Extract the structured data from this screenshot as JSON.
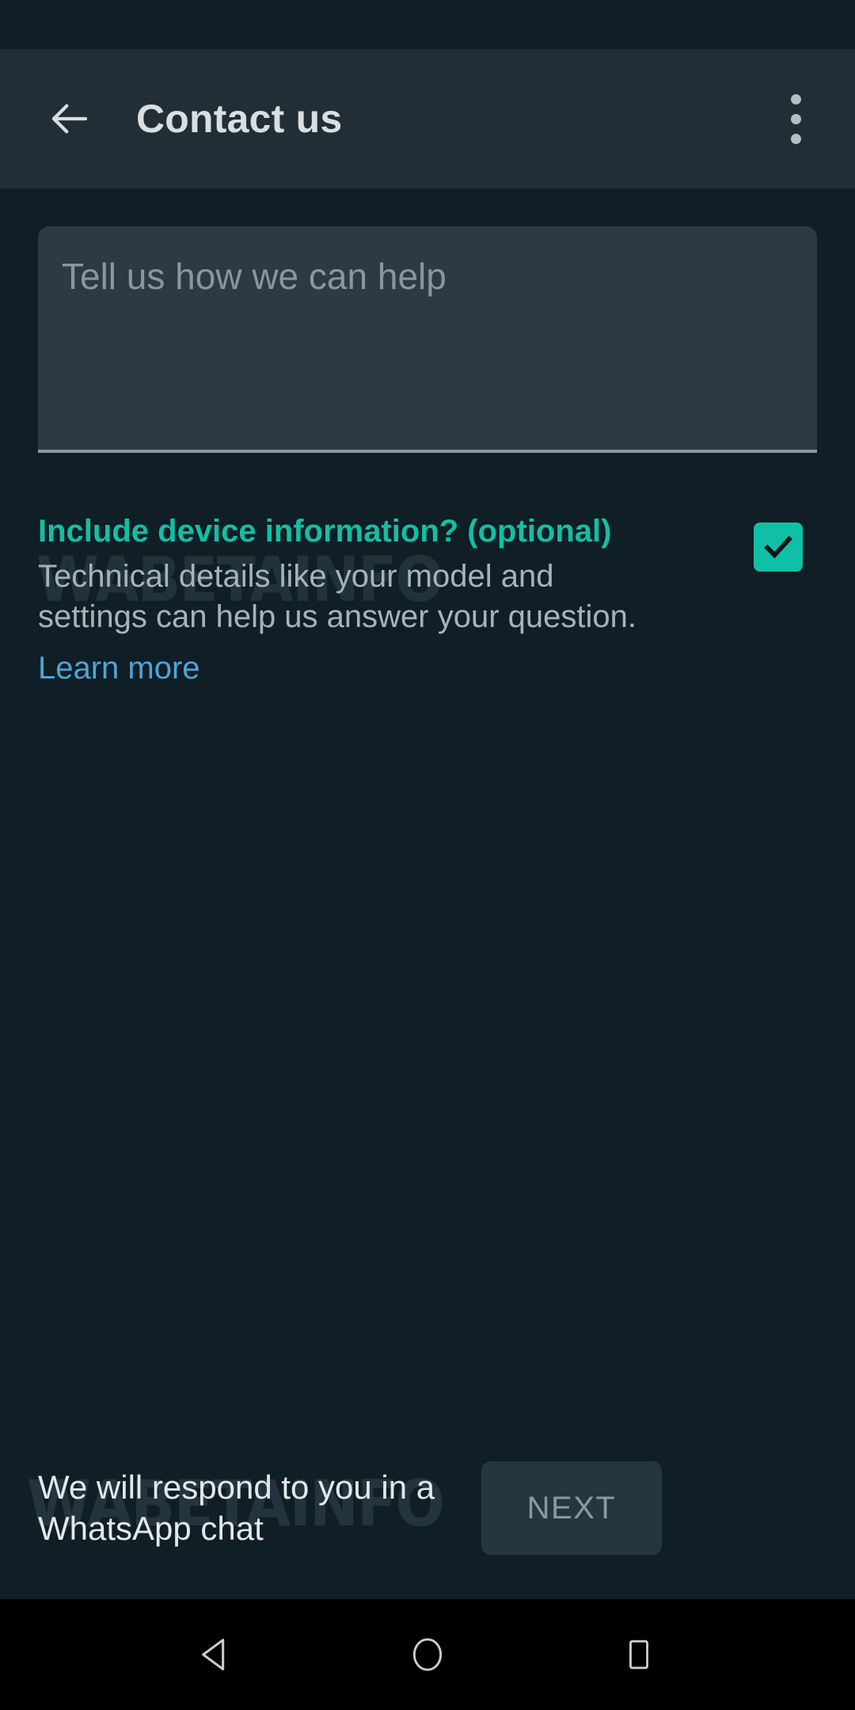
{
  "app_bar": {
    "title": "Contact us",
    "back_icon": "arrow-left-icon",
    "overflow_icon": "more-vertical-icon"
  },
  "message_field": {
    "placeholder": "Tell us how we can help",
    "value": ""
  },
  "device_info": {
    "title": "Include device information? (optional)",
    "description": "Technical details like your model and settings can help us answer your question.",
    "link_label": "Learn more",
    "checkbox_checked": true,
    "checkbox_icon": "check-icon",
    "accent_color": "#12bfa3",
    "link_color": "#4fa4d6",
    "checkbox_color": "#0fc0a7"
  },
  "footer": {
    "note": "We will respond to you in a WhatsApp chat",
    "next_label": "NEXT"
  },
  "watermark": {
    "text": "WABETAINFO"
  },
  "nav_bar": {
    "back_icon": "triangle-back-icon",
    "home_icon": "circle-home-icon",
    "recents_icon": "square-recents-icon"
  },
  "colors": {
    "background": "#101e26",
    "app_bar": "#222e35",
    "status_bar": "#111f27",
    "field": "#2c3a42"
  }
}
